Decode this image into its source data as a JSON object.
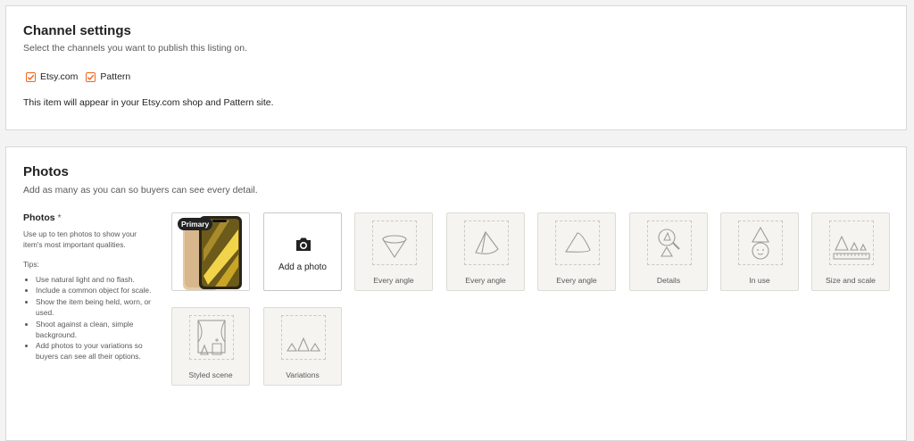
{
  "channel": {
    "title": "Channel settings",
    "subtitle": "Select the channels you want to publish this listing on.",
    "options": [
      {
        "label": "Etsy.com",
        "checked": true
      },
      {
        "label": "Pattern",
        "checked": true
      }
    ],
    "note": "This item will appear in your Etsy.com shop and Pattern site."
  },
  "photos": {
    "title": "Photos",
    "subtitle": "Add as many as you can so buyers can see every detail.",
    "field_label": "Photos",
    "required_mark": "*",
    "help": "Use up to ten photos to show your item's most important qualities.",
    "tips_label": "Tips:",
    "tips": [
      "Use natural light and no flash.",
      "Include a common object for scale.",
      "Show the item being held, worn, or used.",
      "Shoot against a clean, simple background.",
      "Add photos to your variations so buyers can see all their options."
    ],
    "primary_badge": "Primary",
    "add_label": "Add a photo",
    "slots": [
      {
        "label": "Every angle",
        "icon": "cone-icon"
      },
      {
        "label": "Every angle",
        "icon": "cone-tilted-icon"
      },
      {
        "label": "Every angle",
        "icon": "cone-side-icon"
      },
      {
        "label": "Details",
        "icon": "magnifier-cone-icon"
      },
      {
        "label": "In use",
        "icon": "cone-character-icon"
      },
      {
        "label": "Size and scale",
        "icon": "cones-ruler-icon"
      },
      {
        "label": "Styled scene",
        "icon": "window-scene-icon"
      },
      {
        "label": "Variations",
        "icon": "cone-variations-icon"
      }
    ]
  },
  "colors": {
    "accent": "#f1641e",
    "placeholder_bg": "#f5f4f0"
  }
}
